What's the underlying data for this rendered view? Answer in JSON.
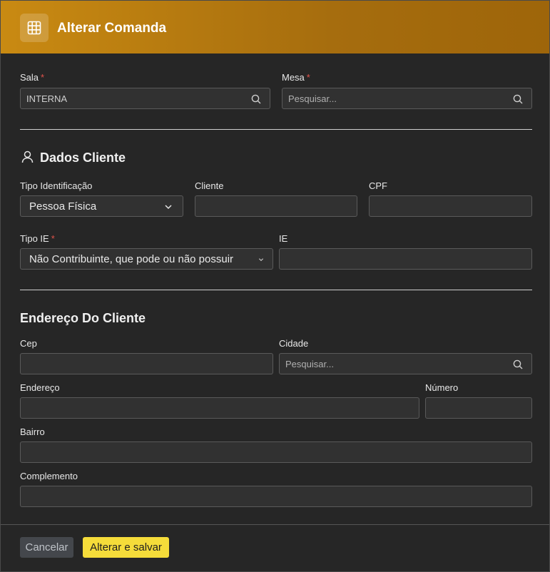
{
  "header": {
    "title": "Alterar Comanda",
    "icon": "grid-icon"
  },
  "room": {
    "sala_label": "Sala",
    "sala_value": "INTERNA",
    "mesa_label": "Mesa",
    "mesa_placeholder": "Pesquisar...",
    "required_mark": "*"
  },
  "client": {
    "title": "Dados Cliente",
    "tipo_id_label": "Tipo Identificação",
    "tipo_id_value": "Pessoa Física",
    "cliente_label": "Cliente",
    "cliente_value": "",
    "cpf_label": "CPF",
    "cpf_value": "",
    "tipo_ie_label": "Tipo IE",
    "tipo_ie_value": "Não Contribuinte, que pode ou não possuir",
    "ie_label": "IE",
    "ie_value": ""
  },
  "address": {
    "title": "Endereço Do Cliente",
    "cep_label": "Cep",
    "cep_value": "",
    "cidade_label": "Cidade",
    "cidade_placeholder": "Pesquisar...",
    "endereco_label": "Endereço",
    "endereco_value": "",
    "numero_label": "Número",
    "numero_value": "",
    "bairro_label": "Bairro",
    "bairro_value": "",
    "complemento_label": "Complemento",
    "complemento_value": ""
  },
  "footer": {
    "cancel_label": "Cancelar",
    "save_label": "Alterar e salvar"
  },
  "colors": {
    "accent": "#c98a12",
    "save_button": "#f5dc3a",
    "required": "#e0524a"
  }
}
